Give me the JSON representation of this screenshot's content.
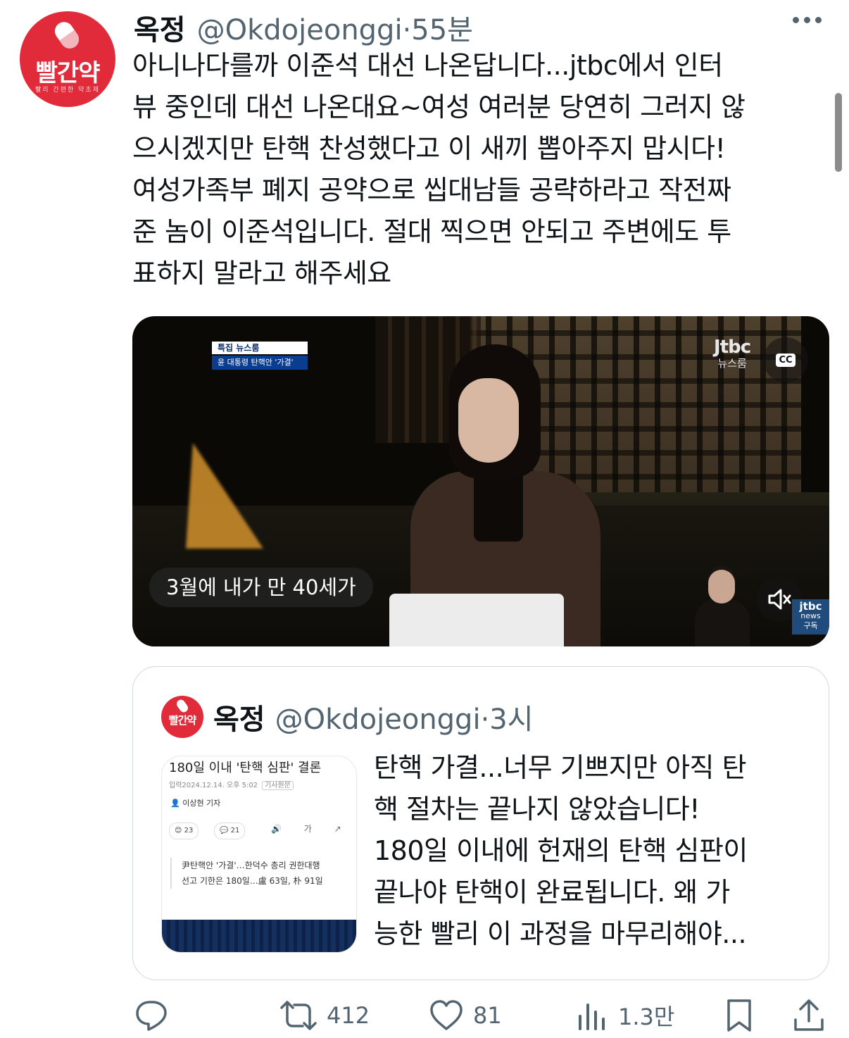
{
  "tweet": {
    "author_name": "옥정",
    "handle": "@Okdojeonggi",
    "separator": "·",
    "time": "55분",
    "avatar_brand": "빨간약",
    "avatar_tagline": "빨리 간편한 약초제",
    "text": "아니나다를까 이준석 대선 나온답니다...jtbc에서 인터\n뷰 중인데 대선 나온대요~여성 여러분 당연히 그러지 않\n으시겠지만 탄핵 찬성했다고 이 새끼 뽑아주지 맙시다!\n여성가족부 폐지 공약으로 씹대남들 공략하라고 작전짜\n준 놈이 이준석입니다. 절대 찍으면 안되고 주변에도 투\n표하지 말라고 해주세요"
  },
  "video": {
    "lower_third_top": "특집 뉴스룸",
    "lower_third_bottom": "윤 대통령 탄핵안 '가결'",
    "channel_logo": "Jtbc",
    "channel_sub": "뉴스룸",
    "cc_label": "CC",
    "caption": "3월에 내가 만 40세가",
    "badge_top": "jtbc",
    "badge_mid": "news",
    "badge_bottom": "구독"
  },
  "quote": {
    "author_name": "옥정",
    "handle": "@Okdojeonggi",
    "separator": "·",
    "time": "3시",
    "avatar_brand": "빨간약",
    "text": "탄핵 가결...너무 기쁘지만 아직 탄\n핵 절차는 끝나지 않았습니다!\n180일 이내에 헌재의 탄핵 심판이\n끝나야 탄핵이 완료됩니다. 왜 가\n능한 빨리 이 과정을 마무리해야...",
    "article": {
      "title": "180일 이내 '탄핵 심판' 결론",
      "meta": "입력2024.12.14. 오후 5:02",
      "meta_box": "기사원문",
      "reporter": "이상현 기자",
      "reactions": "23",
      "comments": "21",
      "tools": "🔊 가 ↗",
      "sub_line1": "尹탄핵안 '가결'…한덕수 총리 권한대행",
      "sub_line2": "선고 기한은 180일…盧 63일, 朴 91일"
    }
  },
  "actions": {
    "reply_count": "",
    "retweet_count": "412",
    "like_count": "81",
    "views_count": "1.3만"
  },
  "icons": {
    "reply": "reply-icon",
    "retweet": "retweet-icon",
    "like": "heart-icon",
    "views": "views-icon",
    "bookmark": "bookmark-icon",
    "share": "share-icon",
    "more": "more-icon",
    "mute": "mute-icon",
    "cc": "cc-icon"
  },
  "colors": {
    "brand_red": "#e22b3a",
    "muted_text": "#536471",
    "border": "#cfd9de"
  }
}
